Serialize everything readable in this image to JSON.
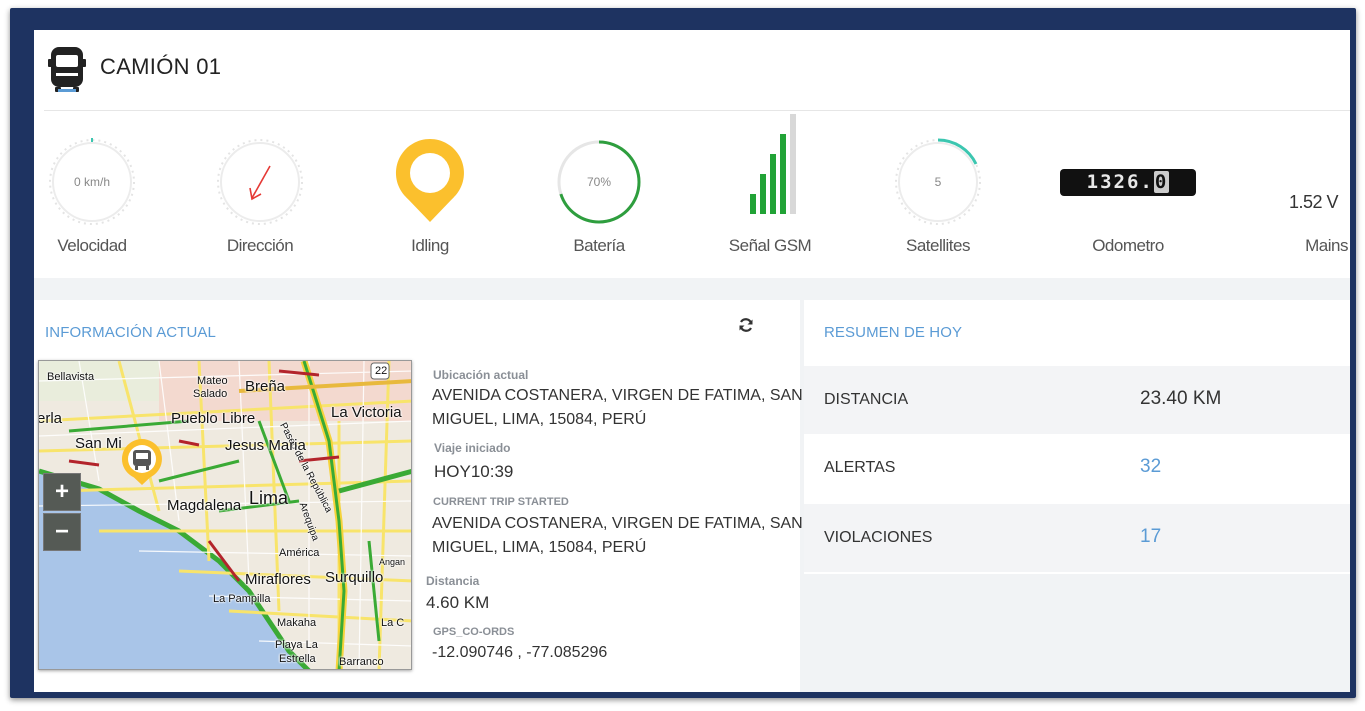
{
  "header": {
    "title": "CAMIÓN 01"
  },
  "gauges": {
    "speed": {
      "value": "0 km/h",
      "label": "Velocidad"
    },
    "direction": {
      "label": "Dirección"
    },
    "status": {
      "label": "Idling"
    },
    "battery": {
      "value": "70%",
      "label": "Batería",
      "level": 0.7
    },
    "gsm": {
      "label": "Señal GSM",
      "bars_filled": 4,
      "bars_total": 5
    },
    "satellites": {
      "value": "5",
      "label": "Satellites"
    },
    "odometer": {
      "digits": "1326",
      "decimal": "0",
      "label": "Odometro"
    },
    "mains": {
      "value": "1.52 V",
      "label": "Mains"
    }
  },
  "current_info": {
    "title": "INFORMACIÓN ACTUAL",
    "location_label": "Ubicación actual",
    "location_line1": "AVENIDA COSTANERA, VIRGEN DE FATIMA, SAN",
    "location_line2": "MIGUEL, LIMA, 15084, PERÚ",
    "trip_started_label": "Viaje iniciado",
    "trip_started_value": "HOY10:39",
    "current_trip_label": "CURRENT TRIP STARTED",
    "current_trip_line1": "AVENIDA COSTANERA, VIRGEN DE FATIMA, SAN",
    "current_trip_line2": "MIGUEL, LIMA, 15084, PERÚ",
    "distance_label": "Distancia",
    "distance_value": "4.60 KM",
    "gps_label": "GPS_CO-ORDS",
    "gps_value": "-12.090746 , -77.085296"
  },
  "map": {
    "zoom_in": "+",
    "zoom_out": "−",
    "labels": {
      "bellavista": "Bellavista",
      "mateo": "Mateo",
      "salado": "Salado",
      "brena": "Breña",
      "route": "22",
      "erla": "erla",
      "pueblo_libre": "Pueblo Libre",
      "la_victoria": "La Victoria",
      "paseo": "Paseo de la República",
      "san_mi": "San Mi",
      "jesus_maria": "Jesus Maria",
      "magdalena": "Magdalena",
      "lima": "Lima",
      "arequipa": "Arequipa",
      "america": "América",
      "angan": "Angan",
      "miraflores": "Miraflores",
      "surquillo": "Surquillo",
      "la_pampilla": "La Pampilla",
      "makaha": "Makaha",
      "la_c": "La C",
      "playa_la": "Playa La",
      "estrella": "Estrella",
      "barranco": "Barranco"
    }
  },
  "summary": {
    "title": "RESUMEN DE HOY",
    "rows": [
      {
        "label": "DISTANCIA",
        "value": "23.40 KM"
      },
      {
        "label": "ALERTAS",
        "value": "32"
      },
      {
        "label": "VIOLACIONES",
        "value": "17"
      }
    ]
  },
  "colors": {
    "frame": "#1e3361",
    "accent": "#5b9bd5",
    "battery": "#2e9e3e",
    "idling": "#fbc02d",
    "satellite": "#3cc6b0",
    "gsm": "#21a336"
  }
}
